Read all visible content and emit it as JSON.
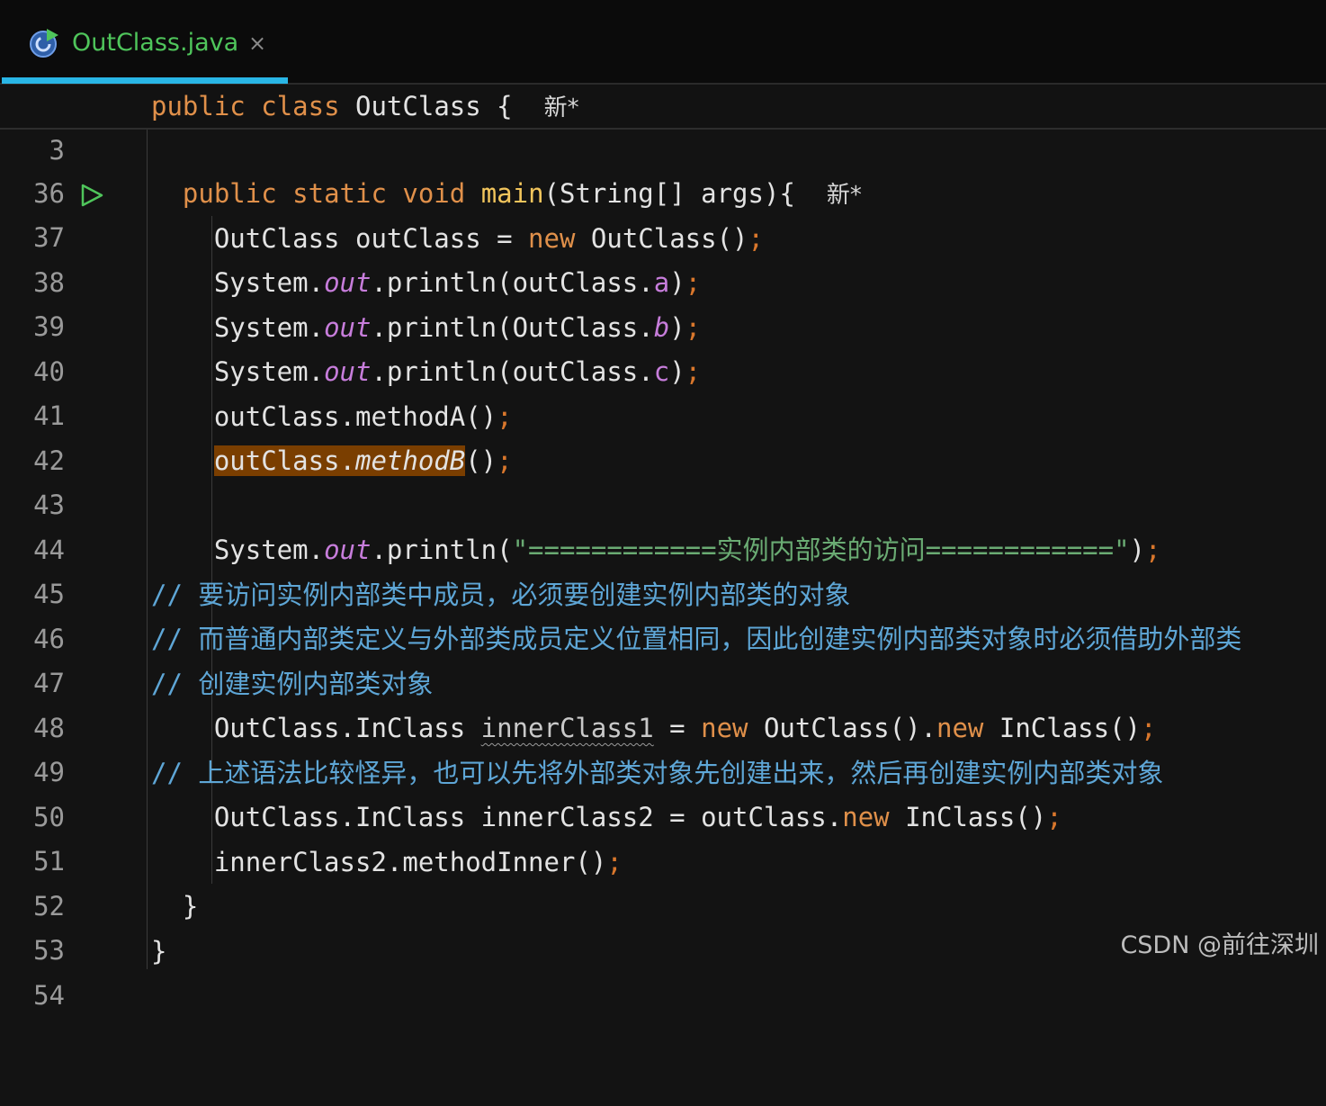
{
  "tab": {
    "title": "OutClass.java",
    "close": "×"
  },
  "sticky": {
    "line_no": "3",
    "kw_public": "public",
    "kw_class": "class",
    "class_name": "OutClass",
    "brace": "{",
    "hint": "新*"
  },
  "lines": [
    {
      "n": "36"
    },
    {
      "n": "37",
      "kw_public": "public",
      "kw_static": "static",
      "kw_void": "void",
      "fn": "main",
      "rest": "(String[] args){",
      "hint": "新*"
    },
    {
      "n": "38",
      "a": "OutClass outClass = ",
      "kw": "new",
      "b": " OutClass()",
      "semi": ";"
    },
    {
      "n": "39",
      "a": "System.",
      "fld": "out",
      "b": ".println(outClass.",
      "f2": "a",
      "c": ")",
      "semi": ";"
    },
    {
      "n": "40",
      "a": "System.",
      "fld": "out",
      "b": ".println(OutClass.",
      "f2": "b",
      "c": ")",
      "semi": ";"
    },
    {
      "n": "41",
      "a": "System.",
      "fld": "out",
      "b": ".println(outClass.",
      "f2": "c",
      "c": ")",
      "semi": ";"
    },
    {
      "n": "42",
      "a": "outClass.methodA()",
      "semi": ";"
    },
    {
      "n": "43",
      "hl_a": "outClass.",
      "hl_b": "methodB",
      "c": "()",
      "semi": ";"
    },
    {
      "n": "44"
    },
    {
      "n": "45",
      "a": "System.",
      "fld": "out",
      "b": ".println(",
      "str": "\"============实例内部类的访问============\"",
      "c": ")",
      "semi": ";"
    },
    {
      "n": "46",
      "cm": "// 要访问实例内部类中成员，必须要创建实例内部类的对象"
    },
    {
      "n": "47",
      "cm": "// 而普通内部类定义与外部类成员定义位置相同，因此创建实例内部类对象时必须借助外部类"
    },
    {
      "n": "48",
      "cm": "// 创建实例内部类对象"
    },
    {
      "n": "49",
      "a": "OutClass.InClass ",
      "wavy": "innerClass1",
      "b": " = ",
      "kw": "new",
      "c": " OutClass().",
      "kw2": "new",
      "d": " InClass()",
      "semi": ";"
    },
    {
      "n": "50",
      "cm": "// 上述语法比较怪异，也可以先将外部类对象先创建出来，然后再创建实例内部类对象"
    },
    {
      "n": "51",
      "a": "OutClass.InClass innerClass2 = outClass.",
      "kw": "new",
      "b": " InClass()",
      "semi": ";"
    },
    {
      "n": "52",
      "a": "innerClass2.methodInner()",
      "semi": ";"
    },
    {
      "n": "53",
      "a": "}"
    },
    {
      "n": "54",
      "a": "}"
    }
  ],
  "watermark": "CSDN @前往深圳"
}
